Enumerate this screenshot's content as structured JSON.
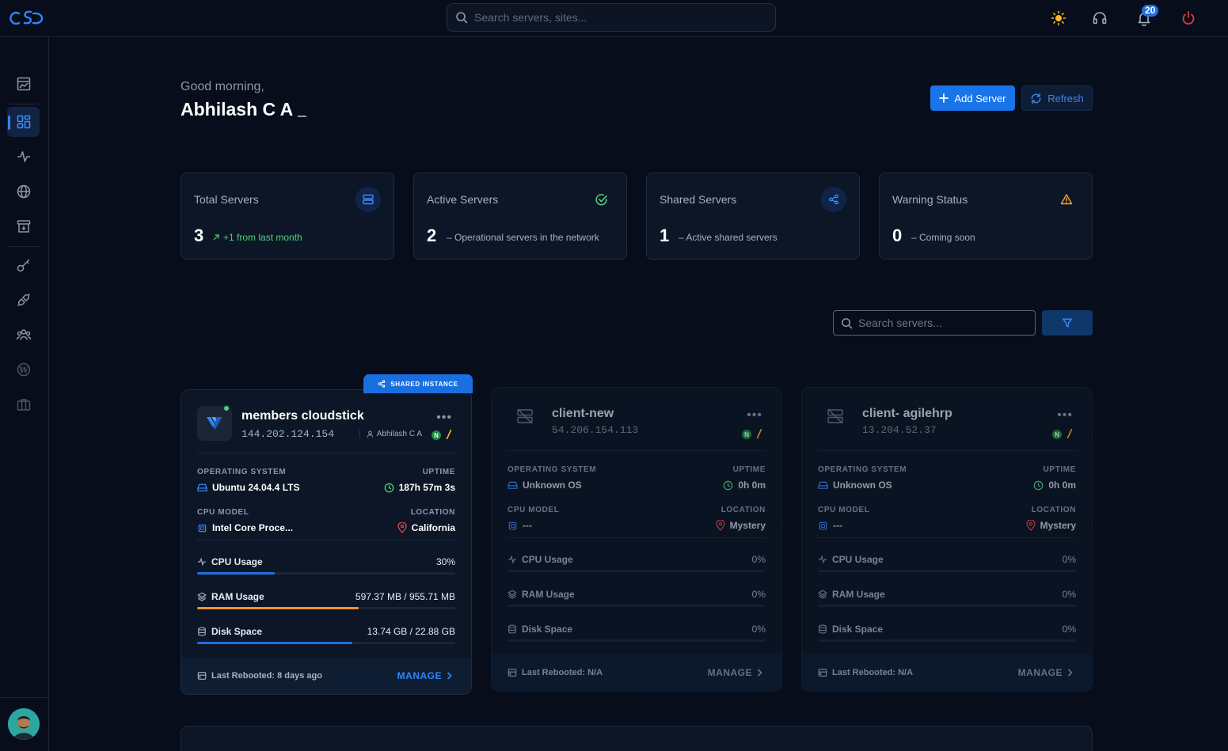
{
  "header": {
    "search_placeholder": "Search servers, sites...",
    "notification_count": "20"
  },
  "greeting": {
    "salutation": "Good morning,",
    "user_name": "Abhilash C A"
  },
  "actions": {
    "add_server": "Add Server",
    "refresh": "Refresh"
  },
  "stats": [
    {
      "label": "Total Servers",
      "value": "3",
      "sub": "+1 from last month"
    },
    {
      "label": "Active Servers",
      "value": "2",
      "sub": "– Operational servers in the network"
    },
    {
      "label": "Shared Servers",
      "value": "1",
      "sub": "– Active shared servers"
    },
    {
      "label": "Warning Status",
      "value": "0",
      "sub": "– Coming soon"
    }
  ],
  "filter": {
    "search_placeholder": "Search servers..."
  },
  "labels": {
    "os": "OPERATING SYSTEM",
    "uptime": "UPTIME",
    "cpu_model": "CPU MODEL",
    "location": "LOCATION",
    "cpu_usage": "CPU Usage",
    "ram_usage": "RAM Usage",
    "disk_space": "Disk Space",
    "manage": "MANAGE",
    "shared_instance": "SHARED INSTANCE"
  },
  "servers": [
    {
      "name": "members cloudstick",
      "ip": "144.202.124.154",
      "owner": "Abhilash C A",
      "os": "Ubuntu 24.04.4 LTS",
      "uptime": "187h 57m 3s",
      "cpu_model": "Intel Core Proce...",
      "location": "California",
      "cpu_usage": "30%",
      "cpu_fraction": 0.3,
      "ram_usage": "597.37 MB / 955.71 MB",
      "ram_fraction": 0.625,
      "disk_space": "13.74 GB / 22.88 GB",
      "disk_fraction": 0.6,
      "last_rebooted": "Last Rebooted: 8 days ago"
    },
    {
      "name": "client-new",
      "ip": "54.206.154.113",
      "os": "Unknown OS",
      "uptime": "0h 0m",
      "cpu_model": "---",
      "location": "Mystery",
      "cpu_usage": "0%",
      "ram_usage": "0%",
      "disk_space": "0%",
      "last_rebooted": "Last Rebooted: N/A"
    },
    {
      "name": "client- agilehrp",
      "ip": "13.204.52.37",
      "os": "Unknown OS",
      "uptime": "0h 0m",
      "cpu_model": "---",
      "location": "Mystery",
      "cpu_usage": "0%",
      "ram_usage": "0%",
      "disk_space": "0%",
      "last_rebooted": "Last Rebooted: N/A"
    }
  ],
  "colors": {
    "accent": "#1874e8",
    "cpu_bar": "#1e6fe0",
    "ram_bar": "#f0932b",
    "disk_bar": "#1e6fe0",
    "success": "#4fd07b",
    "warning": "#f0a030",
    "danger": "#e53935"
  }
}
